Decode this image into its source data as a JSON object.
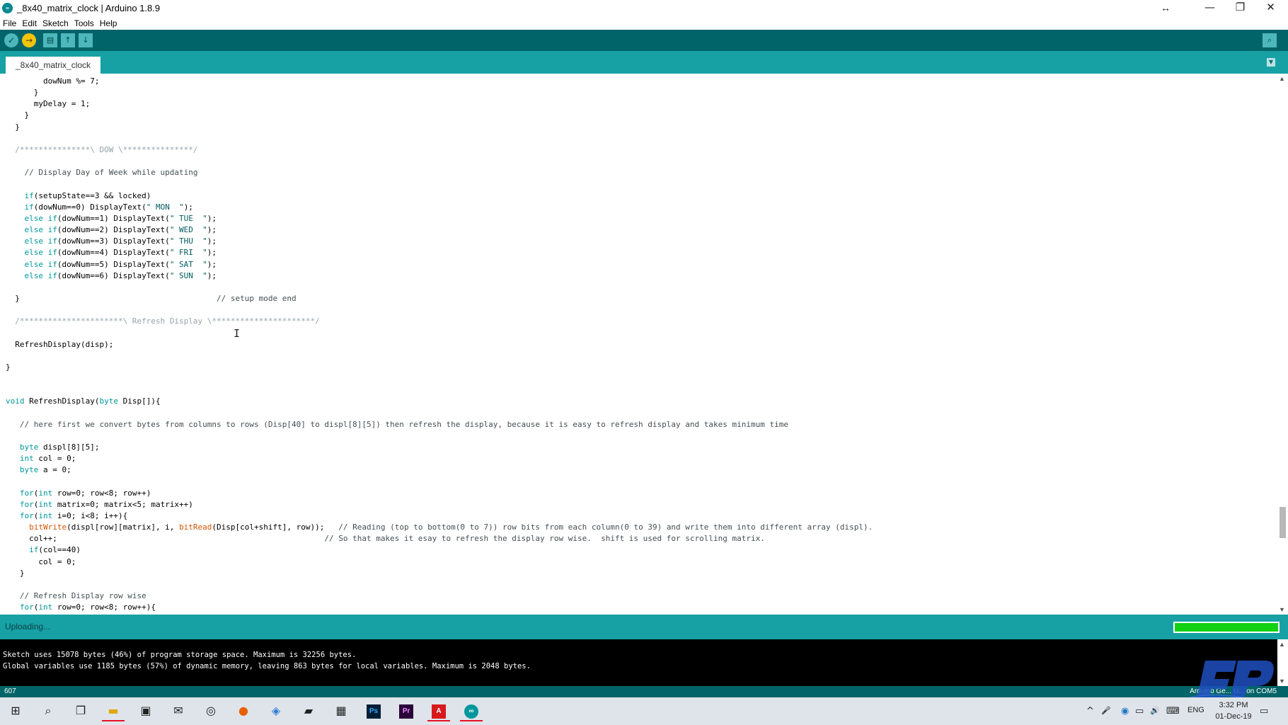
{
  "window": {
    "title": "_8x40_matrix_clock | Arduino 1.8.9",
    "app_icon": "∞",
    "resize_icon": "↔",
    "minimize": "—",
    "maximize": "❐",
    "close": "✕"
  },
  "menu": [
    "File",
    "Edit",
    "Sketch",
    "Tools",
    "Help"
  ],
  "toolbar": {
    "verify_icon": "✓",
    "upload_icon": "→",
    "new_icon": "▤",
    "open_icon": "↑",
    "save_icon": "↓",
    "serial_monitor_icon": "⌕"
  },
  "tab": {
    "label": "_8x40_matrix_clock",
    "menu_icon": "▼"
  },
  "status": {
    "text": "Uploading...",
    "progress": 1.0
  },
  "console": {
    "lines": [
      "Sketch uses 15078 bytes (46%) of program storage space. Maximum is 32256 bytes.",
      "Global variables use 1185 bytes (57%) of dynamic memory, leaving 863 bytes for local variables. Maximum is 2048 bytes."
    ]
  },
  "bottom": {
    "line_number": "607",
    "board_port": "Arduino Ge... U... on COM5"
  },
  "taskbar": {
    "apps": [
      {
        "name": "windows-start",
        "glyph": "⊞"
      },
      {
        "name": "search",
        "glyph": "⌕"
      },
      {
        "name": "task-view",
        "glyph": "❐"
      },
      {
        "name": "file-explorer",
        "glyph": "▬"
      },
      {
        "name": "store",
        "glyph": "▣"
      },
      {
        "name": "mail",
        "glyph": "✉"
      },
      {
        "name": "media",
        "glyph": "◎"
      },
      {
        "name": "firefox",
        "glyph": "●"
      },
      {
        "name": "photos",
        "glyph": "◈"
      },
      {
        "name": "sketch-app",
        "glyph": "▰"
      },
      {
        "name": "document-app",
        "glyph": "▦"
      },
      {
        "name": "photoshop",
        "glyph": "Ps"
      },
      {
        "name": "premiere",
        "glyph": "Pr"
      },
      {
        "name": "acrobat",
        "glyph": "A"
      },
      {
        "name": "arduino",
        "glyph": "∞"
      }
    ],
    "tray": {
      "chevron": "^",
      "mic": "🎤",
      "network": "▭",
      "volume": "🔊",
      "keyboard": "⌨",
      "language": "ENG",
      "time": "3:32 PM",
      "date": "01-Dec-19",
      "notification": "▭"
    }
  },
  "code": [
    [
      {
        "t": "        dowNum %= 7;"
      }
    ],
    [
      {
        "t": "      }"
      }
    ],
    [
      {
        "t": "      myDelay = 1;"
      }
    ],
    [
      {
        "t": "    }"
      }
    ],
    [
      {
        "t": "  }"
      }
    ],
    [],
    [
      {
        "t": "  /***************\\ DOW \\***************/",
        "c": "cm"
      }
    ],
    [],
    [
      {
        "t": "    "
      },
      {
        "t": "// Display Day of Week while updating",
        "c": "cmd"
      }
    ],
    [],
    [
      {
        "t": "    "
      },
      {
        "t": "if",
        "c": "kw"
      },
      {
        "t": "(setupState==3 && locked)"
      }
    ],
    [
      {
        "t": "    "
      },
      {
        "t": "if",
        "c": "kw"
      },
      {
        "t": "(dowNum==0) DisplayText("
      },
      {
        "t": "\" MON  \"",
        "c": "str"
      },
      {
        "t": ");"
      }
    ],
    [
      {
        "t": "    "
      },
      {
        "t": "else if",
        "c": "kw"
      },
      {
        "t": "(dowNum==1) DisplayText("
      },
      {
        "t": "\" TUE  \"",
        "c": "str"
      },
      {
        "t": ");"
      }
    ],
    [
      {
        "t": "    "
      },
      {
        "t": "else if",
        "c": "kw"
      },
      {
        "t": "(dowNum==2) DisplayText("
      },
      {
        "t": "\" WED  \"",
        "c": "str"
      },
      {
        "t": ");"
      }
    ],
    [
      {
        "t": "    "
      },
      {
        "t": "else if",
        "c": "kw"
      },
      {
        "t": "(dowNum==3) DisplayText("
      },
      {
        "t": "\" THU  \"",
        "c": "str"
      },
      {
        "t": ");"
      }
    ],
    [
      {
        "t": "    "
      },
      {
        "t": "else if",
        "c": "kw"
      },
      {
        "t": "(dowNum==4) DisplayText("
      },
      {
        "t": "\" FRI  \"",
        "c": "str"
      },
      {
        "t": ");"
      }
    ],
    [
      {
        "t": "    "
      },
      {
        "t": "else if",
        "c": "kw"
      },
      {
        "t": "(dowNum==5) DisplayText("
      },
      {
        "t": "\" SAT  \"",
        "c": "str"
      },
      {
        "t": ");"
      }
    ],
    [
      {
        "t": "    "
      },
      {
        "t": "else if",
        "c": "kw"
      },
      {
        "t": "(dowNum==6) DisplayText("
      },
      {
        "t": "\" SUN  \"",
        "c": "str"
      },
      {
        "t": ");"
      }
    ],
    [],
    [
      {
        "t": "  }                                          "
      },
      {
        "t": "// setup mode end",
        "c": "cmd"
      }
    ],
    [],
    [
      {
        "t": "  /**********************\\ Refresh Display \\**********************/",
        "c": "cm"
      }
    ],
    [],
    [
      {
        "t": "  RefreshDisplay(disp);"
      }
    ],
    [],
    [
      {
        "t": "}"
      }
    ],
    [],
    [],
    [
      {
        "t": "void",
        "c": "kw"
      },
      {
        "t": " RefreshDisplay("
      },
      {
        "t": "byte",
        "c": "kw"
      },
      {
        "t": " Disp[]){"
      }
    ],
    [],
    [
      {
        "t": "   "
      },
      {
        "t": "// here first we convert bytes from columns to rows (Disp[40] to displ[8][5]) then refresh the display, because it is easy to refresh display and takes minimum time",
        "c": "cmd"
      }
    ],
    [],
    [
      {
        "t": "   "
      },
      {
        "t": "byte",
        "c": "kw"
      },
      {
        "t": " displ[8][5];"
      }
    ],
    [
      {
        "t": "   "
      },
      {
        "t": "int",
        "c": "kw"
      },
      {
        "t": " col = 0;"
      }
    ],
    [
      {
        "t": "   "
      },
      {
        "t": "byte",
        "c": "kw"
      },
      {
        "t": " a = 0;"
      }
    ],
    [],
    [
      {
        "t": "   "
      },
      {
        "t": "for",
        "c": "kw"
      },
      {
        "t": "("
      },
      {
        "t": "int",
        "c": "kw"
      },
      {
        "t": " row=0; row<8; row++)"
      }
    ],
    [
      {
        "t": "   "
      },
      {
        "t": "for",
        "c": "kw"
      },
      {
        "t": "("
      },
      {
        "t": "int",
        "c": "kw"
      },
      {
        "t": " matrix=0; matrix<5; matrix++)"
      }
    ],
    [
      {
        "t": "   "
      },
      {
        "t": "for",
        "c": "kw"
      },
      {
        "t": "("
      },
      {
        "t": "int",
        "c": "kw"
      },
      {
        "t": " i=0; i<8; i++){"
      }
    ],
    [
      {
        "t": "     "
      },
      {
        "t": "bitWrite",
        "c": "fn"
      },
      {
        "t": "(displ[row][matrix], i, "
      },
      {
        "t": "bitRead",
        "c": "fn"
      },
      {
        "t": "(Disp[col+shift], row));   "
      },
      {
        "t": "// Reading (top to bottom(0 to 7)) row bits from each column(0 to 39) and write them into different array (displ).",
        "c": "cmd"
      }
    ],
    [
      {
        "t": "     col++;                                                         "
      },
      {
        "t": "// So that makes it esay to refresh the display row wise.  shift is used for scrolling matrix.",
        "c": "cmd"
      }
    ],
    [
      {
        "t": "     "
      },
      {
        "t": "if",
        "c": "kw"
      },
      {
        "t": "(col==40)"
      }
    ],
    [
      {
        "t": "       col = 0;"
      }
    ],
    [
      {
        "t": "   }"
      }
    ],
    [],
    [
      {
        "t": "   "
      },
      {
        "t": "// Refresh Display row wise",
        "c": "cmd"
      }
    ],
    [
      {
        "t": "   "
      },
      {
        "t": "for",
        "c": "kw"
      },
      {
        "t": "("
      },
      {
        "t": "int",
        "c": "kw"
      },
      {
        "t": " row=0; row<8; row++){"
      }
    ]
  ]
}
